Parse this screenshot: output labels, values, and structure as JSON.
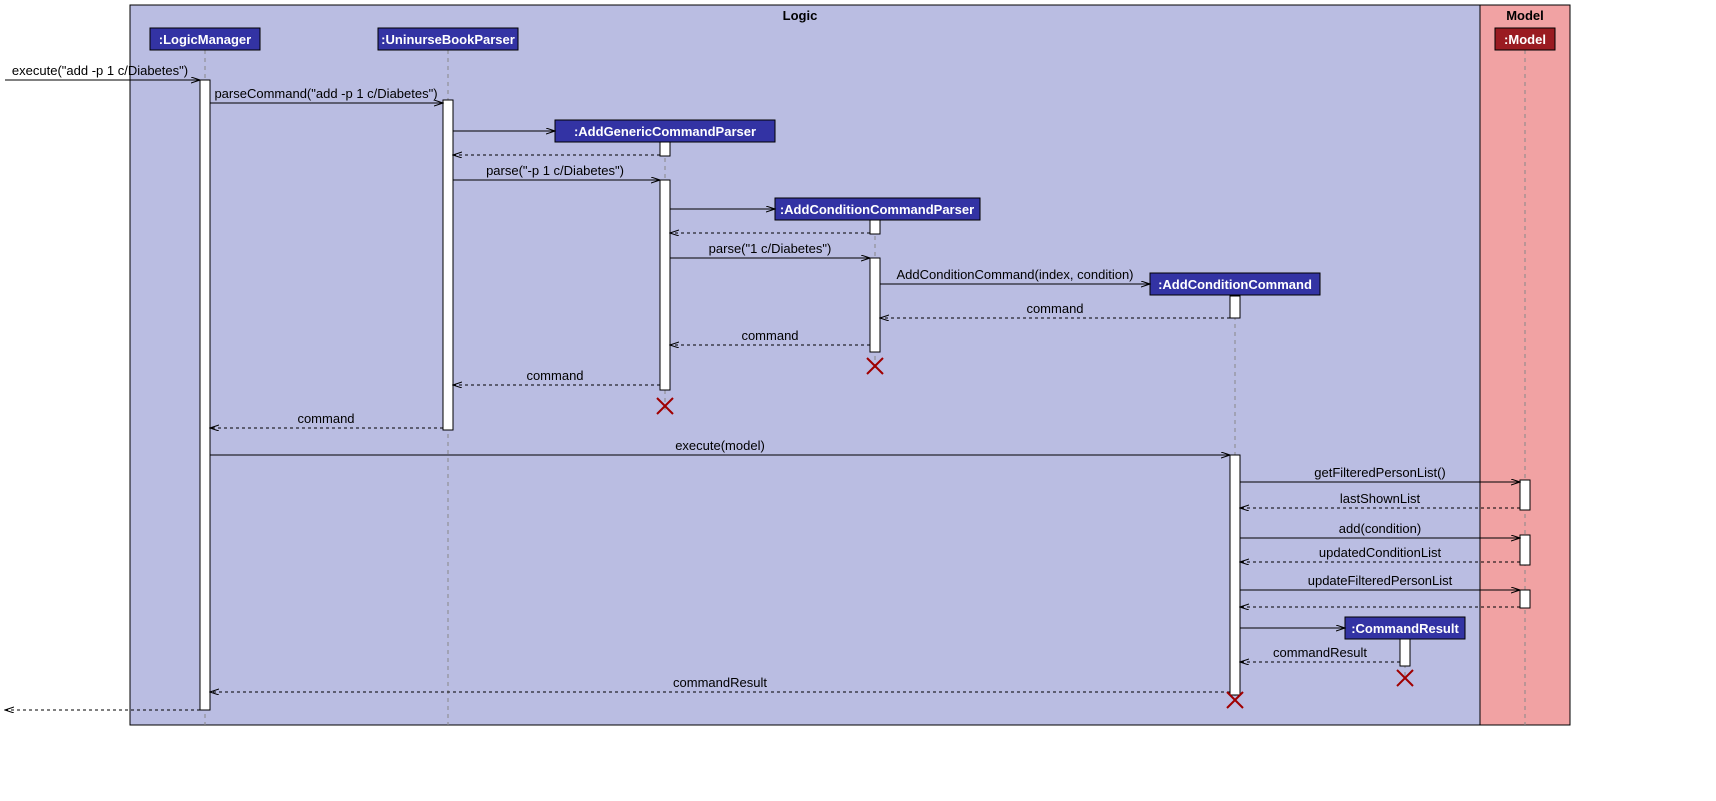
{
  "regions": {
    "logic": "Logic",
    "model": "Model"
  },
  "lifelines": {
    "logicManager": ":LogicManager",
    "uninurseBookParser": ":UninurseBookParser",
    "addGenericCommandParser": ":AddGenericCommandParser",
    "addConditionCommandParser": ":AddConditionCommandParser",
    "addConditionCommand": ":AddConditionCommand",
    "commandResult": ":CommandResult",
    "model": ":Model"
  },
  "messages": {
    "m1": "execute(\"add -p 1 c/Diabetes\")",
    "m2": "parseCommand(\"add -p 1 c/Diabetes\")",
    "m3": "parse(\"-p 1 c/Diabetes\")",
    "m4": "parse(\"1 c/Diabetes\")",
    "m5": "AddConditionCommand(index, condition)",
    "m6": "command",
    "m7": "execute(model)",
    "m8": "getFilteredPersonList()",
    "m9": "lastShownList",
    "m10": "add(condition)",
    "m11": "updatedConditionList",
    "m12": "updateFilteredPersonList",
    "m13": "commandResult"
  }
}
